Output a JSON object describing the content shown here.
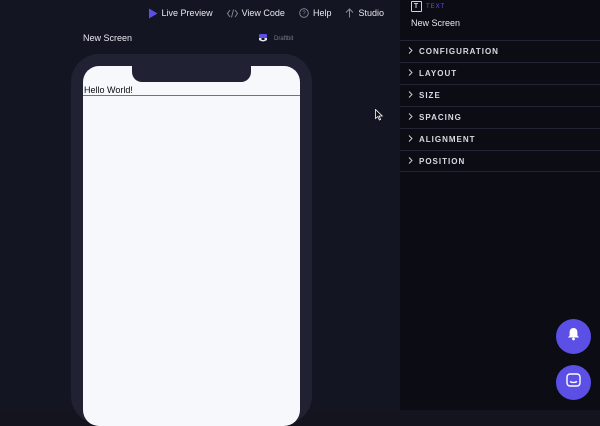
{
  "toolbar": {
    "live_preview": "Live Preview",
    "view_code": "View Code",
    "help": "Help",
    "studio": "Studio"
  },
  "canvas": {
    "screen_title": "New Screen",
    "brand": "Draftbit",
    "hello_text": "Hello World!"
  },
  "panel": {
    "element_type": "TEXT",
    "element_name": "New Screen",
    "sections": [
      "CONFIGURATION",
      "LAYOUT",
      "SIZE",
      "SPACING",
      "ALIGNMENT",
      "POSITION"
    ]
  },
  "colors": {
    "accent": "#5b4fe6",
    "canvas_bg": "#141522",
    "panel_bg": "#0b0c14"
  },
  "icons": {
    "live_preview": "play-icon",
    "view_code": "code-icon",
    "help": "help-icon",
    "studio": "arrow-up-icon",
    "fab_top": "bell-icon",
    "fab_bottom": "chat-icon"
  }
}
